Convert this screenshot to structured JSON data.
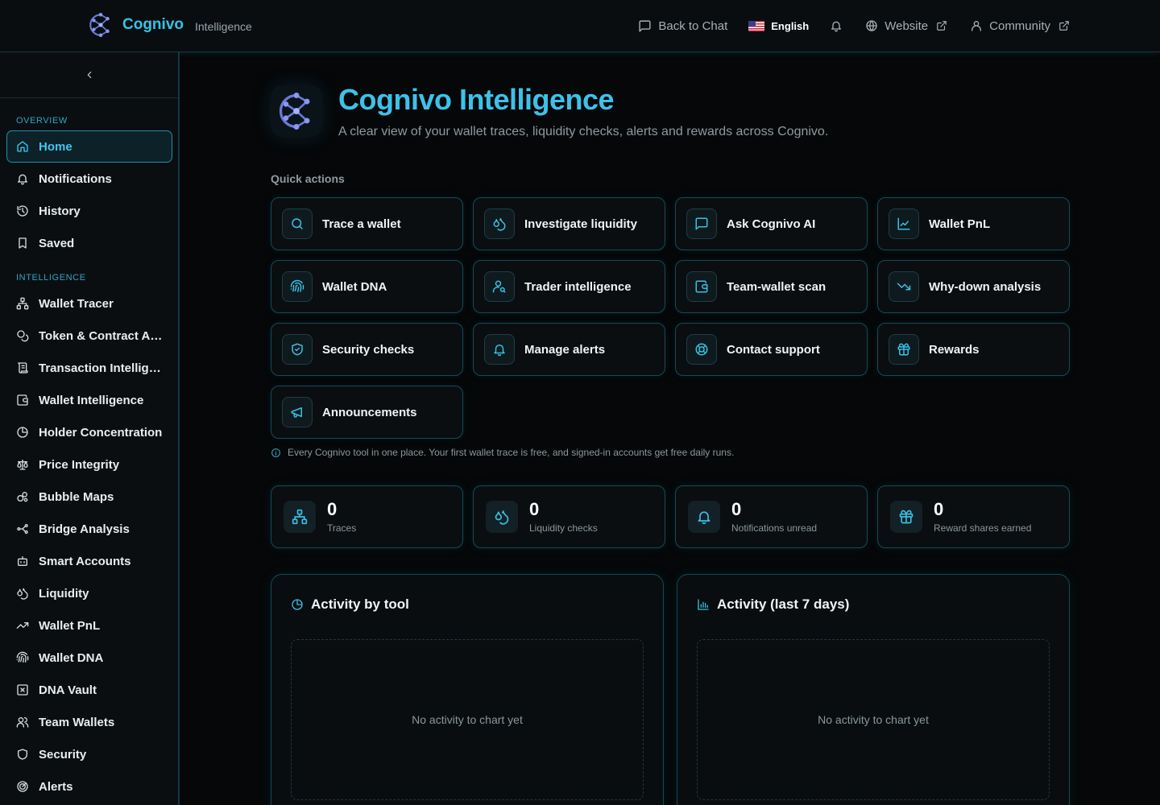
{
  "brand": {
    "name": "Cognivo",
    "sub": "Intelligence"
  },
  "topnav": {
    "back_to_chat": "Back to Chat",
    "language": "English",
    "website": "Website",
    "community": "Community"
  },
  "sidebar": {
    "sections": {
      "overview": "OVERVIEW",
      "intelligence": "INTELLIGENCE"
    },
    "overview_items": [
      {
        "label": "Home",
        "icon": "home-icon",
        "active": true
      },
      {
        "label": "Notifications",
        "icon": "bell-icon"
      },
      {
        "label": "History",
        "icon": "history-icon"
      },
      {
        "label": "Saved",
        "icon": "bookmark-icon"
      }
    ],
    "intelligence_items": [
      {
        "label": "Wallet Tracer",
        "icon": "network-icon"
      },
      {
        "label": "Token & Contract Anal...",
        "icon": "coins-icon"
      },
      {
        "label": "Transaction Intelligen...",
        "icon": "scroll-icon"
      },
      {
        "label": "Wallet Intelligence",
        "icon": "wallet-icon"
      },
      {
        "label": "Holder Concentration",
        "icon": "pie-icon"
      },
      {
        "label": "Price Integrity",
        "icon": "scale-icon"
      },
      {
        "label": "Bubble Maps",
        "icon": "bubbles-icon"
      },
      {
        "label": "Bridge Analysis",
        "icon": "bridge-icon"
      },
      {
        "label": "Smart Accounts",
        "icon": "bot-icon"
      },
      {
        "label": "Liquidity",
        "icon": "droplets-icon"
      },
      {
        "label": "Wallet PnL",
        "icon": "trend-up-icon"
      },
      {
        "label": "Wallet DNA",
        "icon": "fingerprint-icon"
      },
      {
        "label": "DNA Vault",
        "icon": "x-square-icon"
      },
      {
        "label": "Team Wallets",
        "icon": "users-icon"
      },
      {
        "label": "Security",
        "icon": "shield-icon"
      },
      {
        "label": "Alerts",
        "icon": "radar-icon"
      }
    ]
  },
  "hero": {
    "title": "Cognivo Intelligence",
    "subtitle": "A clear view of your wallet traces, liquidity checks, alerts and rewards across Cognivo."
  },
  "quick_actions": {
    "heading": "Quick actions",
    "items": [
      {
        "label": "Trace a wallet",
        "icon": "search-icon"
      },
      {
        "label": "Investigate liquidity",
        "icon": "droplets-icon"
      },
      {
        "label": "Ask Cognivo AI",
        "icon": "chat-icon"
      },
      {
        "label": "Wallet PnL",
        "icon": "line-chart-icon"
      },
      {
        "label": "Wallet DNA",
        "icon": "fingerprint-icon"
      },
      {
        "label": "Trader intelligence",
        "icon": "user-search-icon"
      },
      {
        "label": "Team-wallet scan",
        "icon": "wallet-icon"
      },
      {
        "label": "Why-down analysis",
        "icon": "trend-down-icon"
      },
      {
        "label": "Security checks",
        "icon": "shield-check-icon"
      },
      {
        "label": "Manage alerts",
        "icon": "bell-icon"
      },
      {
        "label": "Contact support",
        "icon": "lifebuoy-icon"
      },
      {
        "label": "Rewards",
        "icon": "gift-icon"
      },
      {
        "label": "Announcements",
        "icon": "megaphone-icon"
      }
    ],
    "info": "Every Cognivo tool in one place. Your first wallet trace is free, and signed-in accounts get free daily runs."
  },
  "stats": [
    {
      "value": "0",
      "caption": "Traces",
      "icon": "network-icon"
    },
    {
      "value": "0",
      "caption": "Liquidity checks",
      "icon": "droplets-icon"
    },
    {
      "value": "0",
      "caption": "Notifications unread",
      "icon": "bell-icon"
    },
    {
      "value": "0",
      "caption": "Reward shares earned",
      "icon": "gift-icon"
    }
  ],
  "panels": [
    {
      "title": "Activity by tool",
      "icon": "pie-icon",
      "empty": "No activity to chart yet"
    },
    {
      "title": "Activity (last 7 days)",
      "icon": "bar-chart-icon",
      "empty": "No activity to chart yet"
    }
  ],
  "colors": {
    "accent": "#35c3e8",
    "background": "#050708",
    "border": "#16495a"
  }
}
